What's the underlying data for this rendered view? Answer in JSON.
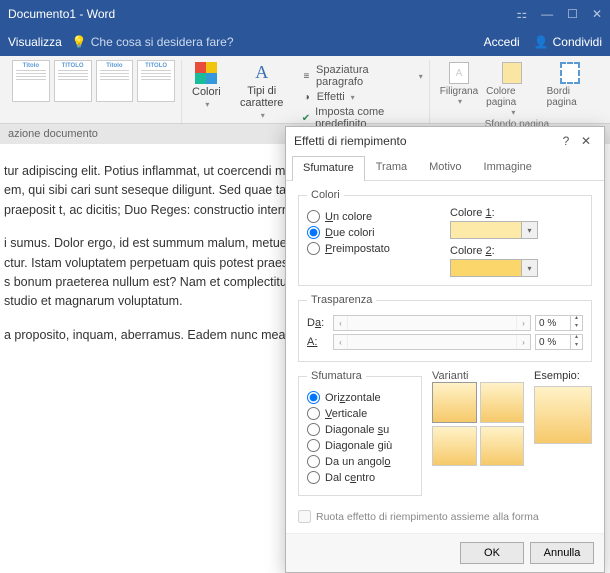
{
  "titlebar": {
    "title": "Documento1 - Word"
  },
  "menubar": {
    "visualizza": "Visualizza",
    "search_placeholder": "Che cosa si desidera fare?",
    "accedi": "Accedi",
    "condividi": "Condividi"
  },
  "ribbon": {
    "thumb_titles": [
      "Titolo",
      "TITOLO",
      "Titolo",
      "TITOLO"
    ],
    "colori": "Colori",
    "tipi_carattere": "Tipi di carattere",
    "spaziatura": "Spaziatura paragrafo",
    "effetti": "Effetti",
    "predefinito": "Imposta come predefinito",
    "filigrana": "Filigrana",
    "colore_pagina": "Colore pagina",
    "bordi_pagina": "Bordi pagina",
    "group_sfondo": "Sfondo pagina"
  },
  "subbar": {
    "label": "azione documento"
  },
  "document": {
    "p1": "tur adipiscing elit. Potius inflammat, ut coercendi magi ur vitiorum magna fit in iis, qui habent ad virtutem pro em, qui sibi cari sunt seseque diligunt. Sed quae tande neglegendi doloris. Quamquam haec quidem praeposit t, ac dicitis; Duo Reges: constructio interrete. Nummus irum. Quonam, inquit, modo?",
    "p2": "i sumus. Dolor ergo, id est summum malum, metuetur rquate, haec dicit Epicurus? Ergo in gubernando nihil, ctur. Istam voluptatem perpetuam quis potest praesta omnia sint paria peccata. Illis videtur, qui illud non dubi s bonum praeterea nullum est? Nam et complectitur v Quod iam a me expectare noli. Suo enim quisque studio et magnarum voluptatum.",
    "p3": "a proposito, inquam, aberramus. Eadem nunc mea ad"
  },
  "dialog": {
    "title": "Effetti di riempimento",
    "tabs": {
      "sfumature": "Sfumature",
      "trama": "Trama",
      "motivo": "Motivo",
      "immagine": "Immagine"
    },
    "colori_legend": "Colori",
    "un_colore": "Un colore",
    "due_colori": "Due colori",
    "preimpostato": "Preimpostato",
    "colore1": "Colore 1:",
    "colore2": "Colore 2:",
    "trasparenza_legend": "Trasparenza",
    "da": "Da:",
    "a": "A:",
    "pct": "0 %",
    "sfumatura_legend": "Sfumatura",
    "orizzontale": "Orizzontale",
    "verticale": "Verticale",
    "diag_su": "Diagonale su",
    "diag_giu": "Diagonale giù",
    "da_angolo": "Da un angolo",
    "dal_centro": "Dal centro",
    "varianti": "Varianti",
    "esempio": "Esempio:",
    "ruota": "Ruota effetto di riempimento assieme alla forma",
    "ok": "OK",
    "annulla": "Annulla"
  }
}
